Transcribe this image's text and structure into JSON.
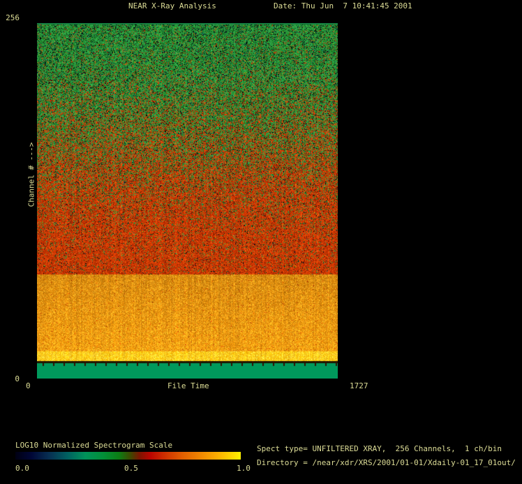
{
  "header": {
    "title": "NEAR X-Ray Analysis",
    "date_label": "Date: Thu Jun  7 10:41:45 2001"
  },
  "plot": {
    "y_axis": {
      "max_label": "256",
      "min_label": "0",
      "title": "Channel # --->"
    },
    "x_axis": {
      "min_label": "0",
      "max_label": "1727",
      "title": "File Time"
    }
  },
  "colorbar": {
    "title": "LOG10 Normalized Spectrogram Scale",
    "tick_low": "0.0",
    "tick_mid": "0.5",
    "tick_high": "1.0",
    "gradient_stops": [
      "#000012 0%",
      "#000636 7%",
      "#072f52 15%",
      "#005f60 23%",
      "#00925a 31%",
      "#029038 39%",
      "#0c7d14 46%",
      "#3d4a00 51%",
      "#7c1500 55%",
      "#bc0500 60%",
      "#d03400 67%",
      "#e25e00 74%",
      "#f08600 82%",
      "#fcab00 89%",
      "#ffd000 95%",
      "#fff200 100%"
    ]
  },
  "info": {
    "line1": "Spect type= UNFILTERED XRAY,  256 Channels,  1 ch/bin",
    "line2": "Directory = /near/xdr/XRS/2001/01-01/Xdaily-01_17_01out/"
  },
  "colors": {
    "background": "#000000",
    "text": "#dcdc96"
  },
  "chart_data": {
    "type": "heatmap",
    "title": "NEAR X-Ray Analysis",
    "xlabel": "File Time",
    "ylabel": "Channel #",
    "x_range": [
      0,
      1727
    ],
    "y_range": [
      0,
      256
    ],
    "legend_position": "bottom-left colorbar",
    "grid": false,
    "colorbar": {
      "label": "LOG10 Normalized Spectrogram Scale",
      "range": [
        0.0,
        1.0
      ],
      "ticks": [
        0.0,
        0.5,
        1.0
      ]
    },
    "bands": [
      {
        "channels": [
          200,
          256
        ],
        "appearance": "green noise with dark navy/black speckles",
        "approx_normalized_value": 0.4
      },
      {
        "channels": [
          95,
          200
        ],
        "appearance": "gradual noisy transition from green (top) to red (bottom)",
        "approx_normalized_value": 0.5
      },
      {
        "channels": [
          75,
          95
        ],
        "appearance": "saturated red noise",
        "approx_normalized_value": 0.62
      },
      {
        "channels": [
          19,
          75
        ],
        "appearance": "orange-gold noise with vertical streaks, brightening downward",
        "approx_normalized_value": 0.85
      },
      {
        "channels": [
          12,
          19
        ],
        "appearance": "bright yellow noise band",
        "approx_normalized_value": 0.97
      },
      {
        "channels": [
          11,
          12
        ],
        "appearance": "dark divider row with short tick marks",
        "approx_normalized_value": 0.55
      },
      {
        "channels": [
          0,
          11
        ],
        "appearance": "uniform sea-green strip",
        "approx_normalized_value": 0.45
      }
    ],
    "render": {
      "top_line_color": "#157c40",
      "green_palette": [
        "#2f9e3c",
        "#25912f",
        "#1c8228",
        "#37aa46",
        "#137020",
        "#2a9a52"
      ],
      "red_palette": [
        "#c83200",
        "#d84000",
        "#b32a00",
        "#e25210",
        "#9c2400",
        "#cc3c08"
      ],
      "dark_palette": [
        "#03142e",
        "#001020",
        "#0a2410",
        "#000000"
      ],
      "accent_palette": [
        "#c87800",
        "#00707a",
        "#b0b000"
      ],
      "orange_palette": [
        "#e8920e",
        "#f2a41c",
        "#d07f06",
        "#fcb224",
        "#dd8a10",
        "#c77a08"
      ],
      "yellow_palette": [
        "#ffd028",
        "#ffc414",
        "#f5b90e",
        "#ffdc46",
        "#eeae08"
      ],
      "strip_color": "#00995c",
      "divider_color": "#1c1600",
      "tick_color": "#301000",
      "red_mix_points": [
        [
          2,
          0.05
        ],
        [
          60,
          0.12
        ],
        [
          120,
          0.32
        ],
        [
          185,
          0.58
        ],
        [
          240,
          0.8
        ],
        [
          300,
          0.92
        ],
        [
          360,
          0.96
        ]
      ],
      "dark_prob_points": [
        [
          2,
          0.16
        ],
        [
          120,
          0.1
        ],
        [
          240,
          0.05
        ],
        [
          360,
          0.03
        ]
      ],
      "regions": {
        "noise_end": 360,
        "orange_end": 470,
        "yellow_end": 484,
        "divider_end": 487,
        "strip_end": 509
      },
      "tick_spacing": 15
    }
  }
}
